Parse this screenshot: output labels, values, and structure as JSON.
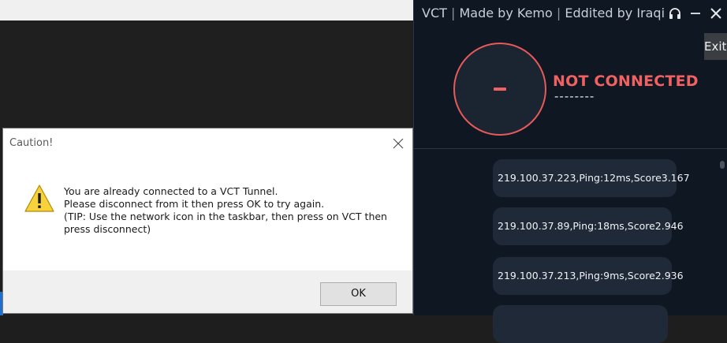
{
  "vct": {
    "title_app": "VCT",
    "title_made": "Made by Kemo",
    "title_edited": "Eddited by Iraqi",
    "exit_label": "Exit",
    "status": "NOT CONNECTED",
    "status_sub": "--------",
    "status_color": "#f06262",
    "servers": [
      {
        "label": "219.100.37.223,Ping:12ms,Score3.167"
      },
      {
        "label": "219.100.37.89,Ping:18ms,Score2.946"
      },
      {
        "label": "219.100.37.213,Ping:9ms,Score2.936"
      },
      {
        "label": ""
      }
    ],
    "icons": [
      "headset-icon",
      "minimize-icon",
      "close-icon"
    ]
  },
  "dialog": {
    "title": "Caution!",
    "lines": [
      "You are already connected to a VCT Tunnel.",
      "Please disconnect from it then press OK to try again.",
      "(TIP: Use the network icon in the taskbar, then press on VCT then",
      "press disconnect)"
    ],
    "ok_label": "OK",
    "icon": "warning-icon"
  }
}
